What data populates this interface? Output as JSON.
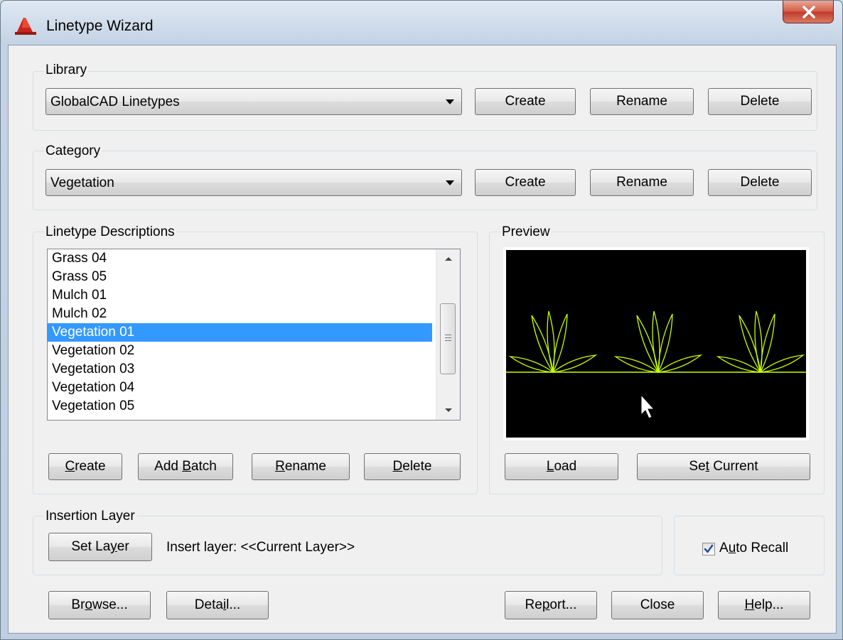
{
  "window": {
    "title": "Linetype Wizard",
    "close_label": "X"
  },
  "library": {
    "label": "Library",
    "selected": "GlobalCAD Linetypes",
    "create": "Create",
    "rename": "Rename",
    "delete": "Delete"
  },
  "category": {
    "label": "Category",
    "selected": "Vegetation",
    "create": "Create",
    "rename": "Rename",
    "delete": "Delete"
  },
  "descriptions": {
    "label": "Linetype Descriptions",
    "items": [
      "Grass 04",
      "Grass 05",
      "Mulch 01",
      "Mulch 02",
      "Vegetation 01",
      "Vegetation 02",
      "Vegetation 03",
      "Vegetation 04",
      "Vegetation 05"
    ],
    "selected_index": 4,
    "create": {
      "pre": "",
      "key": "C",
      "post": "reate"
    },
    "add_batch": {
      "pre": "Add ",
      "key": "B",
      "post": "atch"
    },
    "rename": {
      "pre": "",
      "key": "R",
      "post": "ename"
    },
    "delete": {
      "pre": "",
      "key": "D",
      "post": "elete"
    }
  },
  "preview": {
    "label": "Preview",
    "line_color": "#c8ff00",
    "load": {
      "pre": "",
      "key": "L",
      "post": "oad"
    },
    "set_current": {
      "pre": "Se",
      "key": "t",
      "post": " Current"
    }
  },
  "insertion": {
    "label": "Insertion Layer",
    "set_layer": {
      "pre": "Set La",
      "key": "y",
      "post": "er"
    },
    "insert_text": "Insert layer: <<Current Layer>>"
  },
  "auto_recall": {
    "checked": true,
    "label": {
      "pre": "A",
      "key": "u",
      "post": "to Recall"
    }
  },
  "footer": {
    "browse": {
      "pre": "Br",
      "key": "o",
      "post": "wse..."
    },
    "detail": {
      "pre": "Deta",
      "key": "i",
      "post": "l..."
    },
    "report": {
      "pre": "Re",
      "key": "p",
      "post": "ort..."
    },
    "close": "Close",
    "help": {
      "pre": "",
      "key": "H",
      "post": "elp..."
    }
  },
  "colors": {
    "selection": "#3399ff",
    "preview_background": "#000000"
  }
}
